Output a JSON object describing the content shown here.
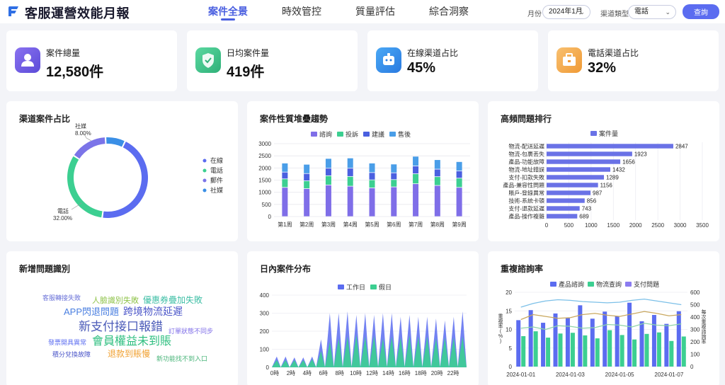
{
  "header": {
    "title": "客服運營效能月報",
    "tabs": [
      {
        "label": "案件全景",
        "active": true
      },
      {
        "label": "時效管控",
        "active": false
      },
      {
        "label": "質量評估",
        "active": false
      },
      {
        "label": "綜合洞察",
        "active": false
      }
    ],
    "month_label": "月份",
    "month_value": "2024年1月",
    "channel_label": "渠道類型",
    "channel_value": "電話",
    "query_button": "查詢"
  },
  "kpis": [
    {
      "label": "案件總量",
      "value": "12,580件",
      "icon": "user-icon",
      "color": "#6a55e6"
    },
    {
      "label": "日均案件量",
      "value": "419件",
      "icon": "shield-check-icon",
      "color": "#34c08a"
    },
    {
      "label": "在線渠道占比",
      "value": "45%",
      "icon": "chat-bot-icon",
      "color": "#2f8ff0"
    },
    {
      "label": "電話渠道占比",
      "value": "32%",
      "icon": "briefcase-icon",
      "color": "#f2a440"
    }
  ],
  "panels": {
    "channel": "渠道案件占比",
    "stack": "案件性質堆疊趨勢",
    "top": "高頻問題排行",
    "words": "新增問題識別",
    "daily": "日內案件分布",
    "repeat": "重複諮詢率"
  },
  "chart_data": [
    {
      "id": "channel",
      "type": "pie",
      "title": "渠道案件占比",
      "slices": [
        {
          "name": "在線",
          "value": 45.0,
          "color": "#5b6cf0"
        },
        {
          "name": "電話",
          "value": 32.0,
          "color": "#3ccf91"
        },
        {
          "name": "郵件",
          "value": 15.0,
          "color": "#7b74e8"
        },
        {
          "name": "社媒",
          "value": 8.0,
          "color": "#3a8fe6"
        }
      ],
      "labels": [
        {
          "name": "社媒",
          "text": "8.00%"
        },
        {
          "name": "電話",
          "text": "32.00%"
        }
      ],
      "legend": "right"
    },
    {
      "id": "stack",
      "type": "bar",
      "stacked": true,
      "title": "案件性質堆疊趨勢",
      "categories": [
        "第1周",
        "第2周",
        "第3周",
        "第4周",
        "第5周",
        "第6周",
        "第7周",
        "第8周",
        "第9周"
      ],
      "series": [
        {
          "name": "諮詢",
          "color": "#7f6ee8",
          "values": [
            1200,
            1150,
            1300,
            1250,
            1180,
            1220,
            1350,
            1280,
            1200
          ]
        },
        {
          "name": "投訴",
          "color": "#3ccf91",
          "values": [
            350,
            320,
            380,
            400,
            330,
            300,
            410,
            360,
            380
          ]
        },
        {
          "name": "建議",
          "color": "#4a60e0",
          "values": [
            280,
            300,
            310,
            340,
            300,
            280,
            320,
            310,
            300
          ]
        },
        {
          "name": "售後",
          "color": "#4a9ee8",
          "values": [
            370,
            380,
            400,
            420,
            390,
            360,
            400,
            390,
            380
          ]
        }
      ],
      "yticks": [
        0,
        500,
        1000,
        1500,
        2000,
        2500,
        3000
      ],
      "ylim": [
        0,
        3000
      ]
    },
    {
      "id": "top",
      "type": "bar",
      "orientation": "horizontal",
      "title": "高頻問題排行",
      "legend_name": "案件量",
      "color": "#6a72e6",
      "categories": [
        "物流-配送延遲",
        "物流-包裹丟失",
        "產品-功能故障",
        "物流-地址錯誤",
        "支付-扣款失敗",
        "產品-兼容性問題",
        "賬戶-登錄異常",
        "技術-系統卡頓",
        "支付-退款延遲",
        "產品-操作複雜"
      ],
      "values": [
        2847,
        1923,
        1656,
        1432,
        1289,
        1156,
        987,
        856,
        743,
        689
      ],
      "xticks": [
        0,
        500,
        1000,
        1500,
        2000,
        2500,
        3000,
        3500
      ],
      "xlim": [
        0,
        3500
      ]
    },
    {
      "id": "words",
      "type": "table",
      "title": "新增問題識別",
      "words": [
        {
          "text": "客服轉接失敗",
          "color": "#6b73d8",
          "size": 9
        },
        {
          "text": "人臉識別失敗",
          "color": "#8fc34a",
          "size": 11
        },
        {
          "text": "優惠券疊加失敗",
          "color": "#3fbfa6",
          "size": 12
        },
        {
          "text": "APP閃退問題",
          "color": "#4a7fe0",
          "size": 13
        },
        {
          "text": "跨境物流延遲",
          "color": "#4a55c8",
          "size": 14
        },
        {
          "text": "新支付接口報錯",
          "color": "#4a5ab8",
          "size": 17
        },
        {
          "text": "訂單狀態不同步",
          "color": "#7f6ee8",
          "size": 9
        },
        {
          "text": "發票開具異常",
          "color": "#5b6cf0",
          "size": 9
        },
        {
          "text": "會員權益未到賬",
          "color": "#2fbf80",
          "size": 16
        },
        {
          "text": "積分兌換故障",
          "color": "#4a55c8",
          "size": 9
        },
        {
          "text": "退款到賬慢",
          "color": "#f0a030",
          "size": 12
        },
        {
          "text": "新功能找不到入口",
          "color": "#4ab57a",
          "size": 9
        }
      ]
    },
    {
      "id": "daily",
      "type": "area",
      "title": "日內案件分布",
      "series": [
        {
          "name": "工作日",
          "color": "#5b6cf0"
        },
        {
          "name": "假日",
          "color": "#3ccf91"
        }
      ],
      "hour_labels": [
        "0時",
        "2時",
        "4時",
        "6時",
        "8時",
        "10時",
        "12時",
        "14時",
        "16時",
        "18時",
        "20時",
        "22時"
      ],
      "peaks_workday": [
        60,
        60,
        55,
        55,
        60,
        155,
        300,
        300,
        310,
        290,
        300,
        290,
        300,
        300,
        280,
        290,
        280,
        280,
        270,
        260,
        280,
        310
      ],
      "peaks_holiday": [
        40,
        40,
        40,
        40,
        45,
        90,
        140,
        160,
        170,
        180,
        170,
        175,
        160,
        170,
        165,
        175,
        170,
        170,
        160,
        165,
        165,
        170
      ],
      "yticks": [
        0,
        100,
        200,
        300,
        400
      ],
      "ylim": [
        0,
        400
      ]
    },
    {
      "id": "repeat",
      "type": "bar",
      "title": "重複諮詢率",
      "ylabel": "重複率(%)",
      "y2label": "每次重複諮詢率",
      "x_labels": [
        "2024-01-01",
        "2024-01-03",
        "2024-01-05",
        "2024-01-07"
      ],
      "series": [
        {
          "name": "產品諮詢",
          "color": "#5b6cf0",
          "values": [
            12.5,
            15.2,
            11.8,
            14.3,
            13.1,
            16.5,
            12.9,
            14.8,
            13.6,
            17.2,
            12.2,
            13.9,
            11.5,
            14.9
          ]
        },
        {
          "name": "物流查詢",
          "color": "#3ccf91",
          "values": [
            8.2,
            9.5,
            7.8,
            8.9,
            9.1,
            8.4,
            7.6,
            9.8,
            8.5,
            7.3,
            8.8,
            9.2,
            6.9,
            8.1
          ]
        },
        {
          "name": "支付問題",
          "color": "#8b7cf0"
        }
      ],
      "line_series": [
        {
          "color": "#7cc0e8",
          "values": [
            480,
            510,
            530,
            540,
            535,
            525,
            520,
            515,
            520,
            535,
            545,
            530,
            515,
            500
          ]
        },
        {
          "color": "#c9a860",
          "values": [
            380,
            420,
            405,
            390,
            395,
            420,
            430,
            415,
            405,
            425,
            445,
            430,
            410,
            420
          ]
        },
        {
          "color": "#8fd4a8",
          "values": [
            310,
            320,
            300,
            330,
            325,
            310,
            315,
            340,
            335,
            320,
            350,
            335,
            330,
            345
          ]
        }
      ],
      "yticks": [
        0,
        5,
        10,
        15,
        20
      ],
      "ylim": [
        0,
        20
      ],
      "y2ticks": [
        0,
        100,
        200,
        300,
        400,
        500,
        600
      ],
      "y2lim": [
        0,
        600
      ]
    }
  ]
}
